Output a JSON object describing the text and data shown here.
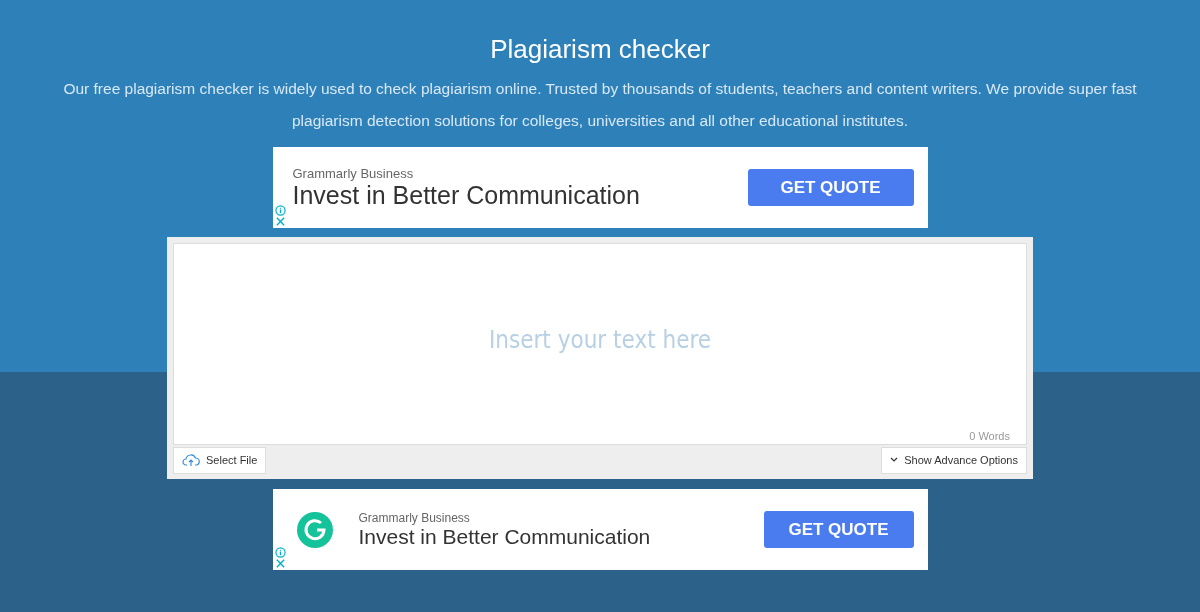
{
  "header": {
    "title": "Plagiarism checker",
    "description": "Our free plagiarism checker is widely used to check plagiarism online. Trusted by thousands of students, teachers and content writers. We provide super fast plagiarism detection solutions for colleges, universities and all other educational institutes."
  },
  "ads": [
    {
      "kind": "plain",
      "brand": "Grammarly Business",
      "headline": "Invest in Better Communication",
      "button": "GET QUOTE"
    },
    {
      "kind": "logo",
      "brand": "Grammarly Business",
      "headline": "Invest in Better Communication",
      "button": "GET QUOTE"
    }
  ],
  "editor": {
    "placeholder": "Insert your text here",
    "word_count": "0 Words",
    "select_file": "Select File",
    "advance_options": "Show Advance Options"
  }
}
